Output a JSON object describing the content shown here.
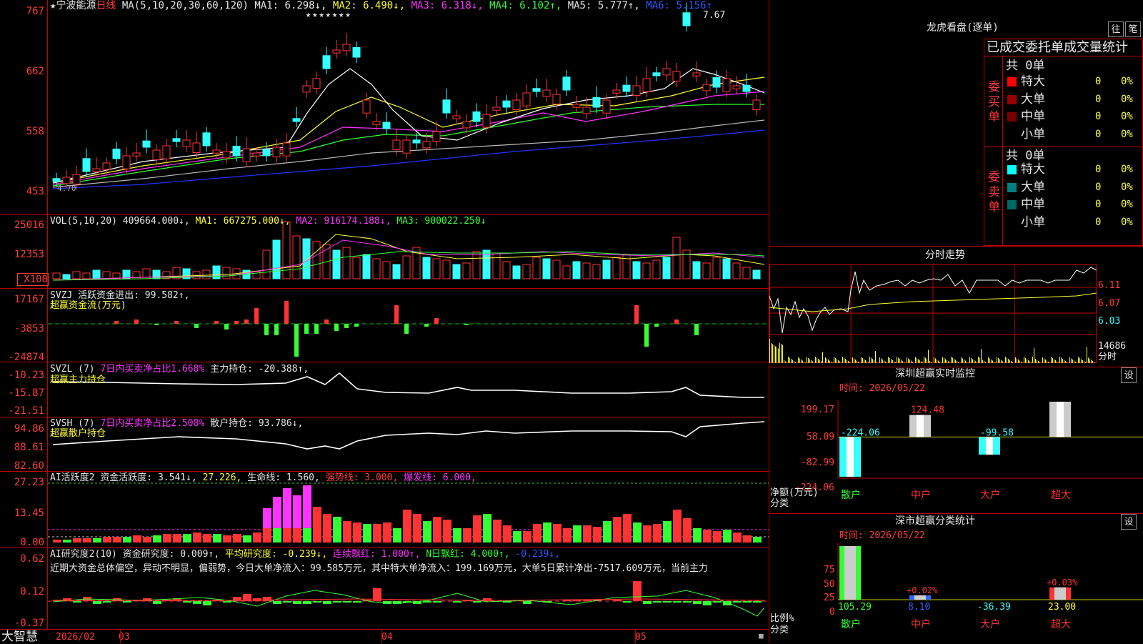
{
  "header": {
    "star": "★",
    "stock_name": "宁波能源",
    "period": "日线",
    "ma_label": "MA(5,10,20,30,60,120)",
    "ma1": "MA1: 6.298↓,",
    "ma2": "MA2: 6.490↓,",
    "ma3": "MA3: 6.318↓,",
    "ma4": "MA4: 6.102↑,",
    "ma5": "MA5: 5.777↑,",
    "ma6": "MA6: 5.156↑",
    "stars": "★★★★★★★",
    "high_mark": "7.67",
    "low_mark": "4.70"
  },
  "main_axis": [
    "767",
    "662",
    "558",
    "453"
  ],
  "vol": {
    "label": "VOL(5,10,20)",
    "value": "409664.000↓,",
    "ma1": "MA1: 667275.000↓,",
    "ma2": "MA2: 916174.188↓,",
    "ma3": "MA3: 900022.250↓",
    "axis": [
      "25016",
      "12353",
      "X100"
    ]
  },
  "svzj": {
    "label": "SVZJ  活跃资金进出: 99.582↑,",
    "sub": "超赢资金流(万元)",
    "axis": [
      "17167",
      "-3853",
      "-24874"
    ]
  },
  "svzl": {
    "label": "SVZL (7)",
    "pct": "7日内买卖净占比1.668%",
    "hold": "主力持仓: -20.388↑,",
    "sub": "超赢主力持仓",
    "axis": [
      "-10.23",
      "-15.87",
      "-21.51"
    ]
  },
  "svsh": {
    "label": "SVSH (7)",
    "pct": "7日内买卖净占比2.508%",
    "hold": "散户持仓: 93.786↓,",
    "sub": "超赢散户持仓",
    "axis": [
      "94.86",
      "88.61",
      "82.60"
    ]
  },
  "ai_active": {
    "label": "AI活跃度2 资金活跃度: 3.541↓,",
    "v2": "27.226,",
    "life": "生命线: 1.560,",
    "strong": "强势线: 3.000,",
    "burst": "爆发线: 6.000,",
    "axis": [
      "27.23",
      "13.45",
      "0.00"
    ]
  },
  "ai_research": {
    "label": "AI研究度2(10) 资金研究度: 0.009↑,",
    "avg": "平均研究度: -0.239↓,",
    "cont": "连续飘红: 1.000↑,",
    "ndays": "N日飘红: 4.000↑,",
    "last": "-0.239↓,",
    "comment": "近期大资金总体偏空，异动不明显，偏弱势，今日大单净流入：99.585万元，其中特大单净流入：199.169万元，大单5日累计净出-7517.609万元，当前主力",
    "axis": [
      "0.62",
      "0.12",
      "-0.37"
    ]
  },
  "x_axis": {
    "brand": "大智慧",
    "labels": [
      "2026/02",
      "03",
      "04",
      "05"
    ]
  },
  "right": {
    "title": "龙虎看盘(逐单)",
    "btn1": "往",
    "btn2": "笔",
    "tabs": "已成交委托单成交量统计",
    "buy_label": "委买单",
    "sell_label": "委卖单",
    "buy_total": "共 0单",
    "sell_total": "共 0单",
    "buy_rows": [
      {
        "name": "特大",
        "count": "0",
        "pct": "0%",
        "color": "#ff0000"
      },
      {
        "name": "大单",
        "count": "0",
        "pct": "0%",
        "color": "#990000"
      },
      {
        "name": "中单",
        "count": "0",
        "pct": "0%",
        "color": "#770000"
      },
      {
        "name": "小单",
        "count": "0",
        "pct": "0%",
        "color": "#000000"
      }
    ],
    "sell_rows": [
      {
        "name": "特大",
        "count": "0",
        "pct": "0%",
        "color": "#00ffff"
      },
      {
        "name": "大单",
        "count": "0",
        "pct": "0%",
        "color": "#008080"
      },
      {
        "name": "中单",
        "count": "0",
        "pct": "0%",
        "color": "#006666"
      },
      {
        "name": "小单",
        "count": "0",
        "pct": "0%",
        "color": "#000000"
      }
    ],
    "intraday_title": "分时走势",
    "intraday_axis": [
      "6.11",
      "6.07",
      "6.03",
      "14686"
    ],
    "intraday_unit": "分时",
    "monitor_title": "深圳超赢实时监控",
    "monitor_btn": "设",
    "monitor_time": "时间: 2026/05/22",
    "monitor_axis": [
      "199.17",
      "58.09",
      "-82.99",
      "-224.06"
    ],
    "monitor_unit1": "净额(万元)",
    "monitor_unit2": "分类",
    "stats_title": "深市超赢分类统计",
    "stats_btn": "设",
    "stats_time": "时间: 2026/05/22",
    "stats_axis": [
      "75",
      "50",
      "25",
      "0"
    ],
    "stats_unit1": "比例%",
    "stats_unit2": "分类",
    "categories": [
      "散户",
      "中户",
      "大户",
      "超大"
    ]
  },
  "chart_data": [
    {
      "type": "bar",
      "title": "深圳超赢实时监控",
      "ylabel": "净额(万元)",
      "categories": [
        "散户",
        "中户",
        "大户",
        "超大"
      ],
      "values": [
        -224.06,
        124.48,
        -99.58,
        199.17
      ],
      "value_labels": [
        "-224.06",
        "124.48",
        "-99.58",
        "199.17"
      ],
      "ylim": [
        -224.06,
        199.17
      ]
    },
    {
      "type": "bar",
      "title": "深市超赢分类统计",
      "ylabel": "比例%",
      "categories": [
        "散户",
        "中户",
        "大户",
        "超大"
      ],
      "values": [
        105.29,
        8.1,
        -36.39,
        23.0
      ],
      "value_labels": [
        "105.29",
        "8.10",
        "-36.39",
        "23.00"
      ],
      "bar_pct": [
        100,
        8.1,
        0,
        23
      ],
      "top_labels": [
        "",
        "+0.02%",
        "",
        "+0.03%"
      ],
      "ylim": [
        0,
        100
      ]
    }
  ]
}
